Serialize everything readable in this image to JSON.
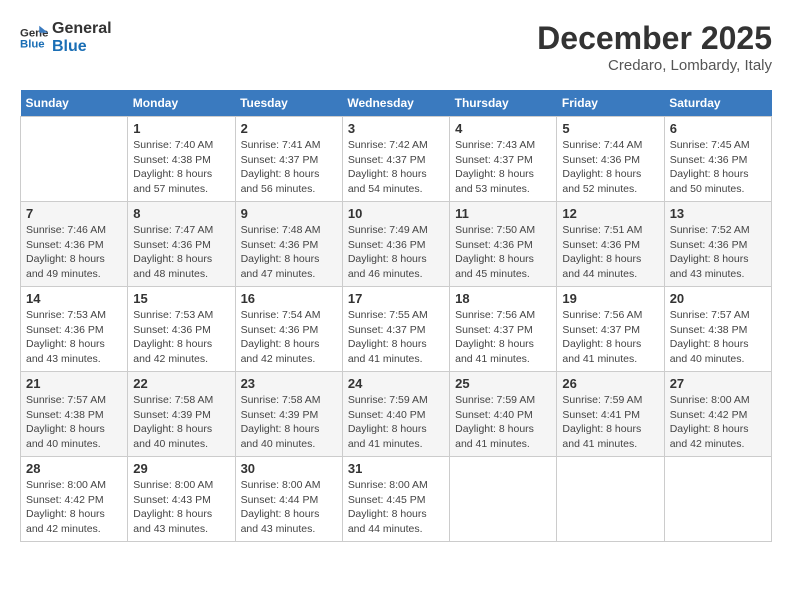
{
  "logo": {
    "line1": "General",
    "line2": "Blue"
  },
  "title": "December 2025",
  "subtitle": "Credaro, Lombardy, Italy",
  "days_of_week": [
    "Sunday",
    "Monday",
    "Tuesday",
    "Wednesday",
    "Thursday",
    "Friday",
    "Saturday"
  ],
  "weeks": [
    [
      {
        "day": "",
        "info": ""
      },
      {
        "day": "1",
        "info": "Sunrise: 7:40 AM\nSunset: 4:38 PM\nDaylight: 8 hours\nand 57 minutes."
      },
      {
        "day": "2",
        "info": "Sunrise: 7:41 AM\nSunset: 4:37 PM\nDaylight: 8 hours\nand 56 minutes."
      },
      {
        "day": "3",
        "info": "Sunrise: 7:42 AM\nSunset: 4:37 PM\nDaylight: 8 hours\nand 54 minutes."
      },
      {
        "day": "4",
        "info": "Sunrise: 7:43 AM\nSunset: 4:37 PM\nDaylight: 8 hours\nand 53 minutes."
      },
      {
        "day": "5",
        "info": "Sunrise: 7:44 AM\nSunset: 4:36 PM\nDaylight: 8 hours\nand 52 minutes."
      },
      {
        "day": "6",
        "info": "Sunrise: 7:45 AM\nSunset: 4:36 PM\nDaylight: 8 hours\nand 50 minutes."
      }
    ],
    [
      {
        "day": "7",
        "info": "Sunrise: 7:46 AM\nSunset: 4:36 PM\nDaylight: 8 hours\nand 49 minutes."
      },
      {
        "day": "8",
        "info": "Sunrise: 7:47 AM\nSunset: 4:36 PM\nDaylight: 8 hours\nand 48 minutes."
      },
      {
        "day": "9",
        "info": "Sunrise: 7:48 AM\nSunset: 4:36 PM\nDaylight: 8 hours\nand 47 minutes."
      },
      {
        "day": "10",
        "info": "Sunrise: 7:49 AM\nSunset: 4:36 PM\nDaylight: 8 hours\nand 46 minutes."
      },
      {
        "day": "11",
        "info": "Sunrise: 7:50 AM\nSunset: 4:36 PM\nDaylight: 8 hours\nand 45 minutes."
      },
      {
        "day": "12",
        "info": "Sunrise: 7:51 AM\nSunset: 4:36 PM\nDaylight: 8 hours\nand 44 minutes."
      },
      {
        "day": "13",
        "info": "Sunrise: 7:52 AM\nSunset: 4:36 PM\nDaylight: 8 hours\nand 43 minutes."
      }
    ],
    [
      {
        "day": "14",
        "info": "Sunrise: 7:53 AM\nSunset: 4:36 PM\nDaylight: 8 hours\nand 43 minutes."
      },
      {
        "day": "15",
        "info": "Sunrise: 7:53 AM\nSunset: 4:36 PM\nDaylight: 8 hours\nand 42 minutes."
      },
      {
        "day": "16",
        "info": "Sunrise: 7:54 AM\nSunset: 4:36 PM\nDaylight: 8 hours\nand 42 minutes."
      },
      {
        "day": "17",
        "info": "Sunrise: 7:55 AM\nSunset: 4:37 PM\nDaylight: 8 hours\nand 41 minutes."
      },
      {
        "day": "18",
        "info": "Sunrise: 7:56 AM\nSunset: 4:37 PM\nDaylight: 8 hours\nand 41 minutes."
      },
      {
        "day": "19",
        "info": "Sunrise: 7:56 AM\nSunset: 4:37 PM\nDaylight: 8 hours\nand 41 minutes."
      },
      {
        "day": "20",
        "info": "Sunrise: 7:57 AM\nSunset: 4:38 PM\nDaylight: 8 hours\nand 40 minutes."
      }
    ],
    [
      {
        "day": "21",
        "info": "Sunrise: 7:57 AM\nSunset: 4:38 PM\nDaylight: 8 hours\nand 40 minutes."
      },
      {
        "day": "22",
        "info": "Sunrise: 7:58 AM\nSunset: 4:39 PM\nDaylight: 8 hours\nand 40 minutes."
      },
      {
        "day": "23",
        "info": "Sunrise: 7:58 AM\nSunset: 4:39 PM\nDaylight: 8 hours\nand 40 minutes."
      },
      {
        "day": "24",
        "info": "Sunrise: 7:59 AM\nSunset: 4:40 PM\nDaylight: 8 hours\nand 41 minutes."
      },
      {
        "day": "25",
        "info": "Sunrise: 7:59 AM\nSunset: 4:40 PM\nDaylight: 8 hours\nand 41 minutes."
      },
      {
        "day": "26",
        "info": "Sunrise: 7:59 AM\nSunset: 4:41 PM\nDaylight: 8 hours\nand 41 minutes."
      },
      {
        "day": "27",
        "info": "Sunrise: 8:00 AM\nSunset: 4:42 PM\nDaylight: 8 hours\nand 42 minutes."
      }
    ],
    [
      {
        "day": "28",
        "info": "Sunrise: 8:00 AM\nSunset: 4:42 PM\nDaylight: 8 hours\nand 42 minutes."
      },
      {
        "day": "29",
        "info": "Sunrise: 8:00 AM\nSunset: 4:43 PM\nDaylight: 8 hours\nand 43 minutes."
      },
      {
        "day": "30",
        "info": "Sunrise: 8:00 AM\nSunset: 4:44 PM\nDaylight: 8 hours\nand 43 minutes."
      },
      {
        "day": "31",
        "info": "Sunrise: 8:00 AM\nSunset: 4:45 PM\nDaylight: 8 hours\nand 44 minutes."
      },
      {
        "day": "",
        "info": ""
      },
      {
        "day": "",
        "info": ""
      },
      {
        "day": "",
        "info": ""
      }
    ]
  ]
}
